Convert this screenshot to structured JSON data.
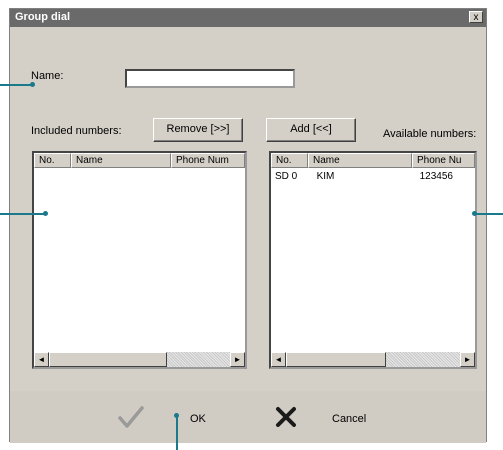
{
  "window": {
    "title": "Group dial",
    "close_glyph": "x"
  },
  "form": {
    "name_label": "Name:",
    "name_value": "",
    "included_label": "Included numbers:",
    "available_label": "Available numbers:"
  },
  "buttons": {
    "remove": "Remove [>>]",
    "add": "Add [<<]",
    "ok": "OK",
    "cancel": "Cancel"
  },
  "included_list": {
    "columns": [
      "No.",
      "Name",
      "Phone Num"
    ],
    "rows": []
  },
  "available_list": {
    "columns": [
      "No.",
      "Name",
      "Phone Nu"
    ],
    "rows": [
      {
        "no": "SD 0",
        "name": "KIM",
        "phone": "123456"
      }
    ]
  },
  "scroll": {
    "left_arrow": "◄",
    "right_arrow": "►"
  },
  "icons": {
    "ok": "checkmark-icon",
    "cancel": "x-icon"
  },
  "colors": {
    "callout": "#1a7a8c",
    "titlebar": "#6a6a6a",
    "face": "#d4d0c8"
  }
}
